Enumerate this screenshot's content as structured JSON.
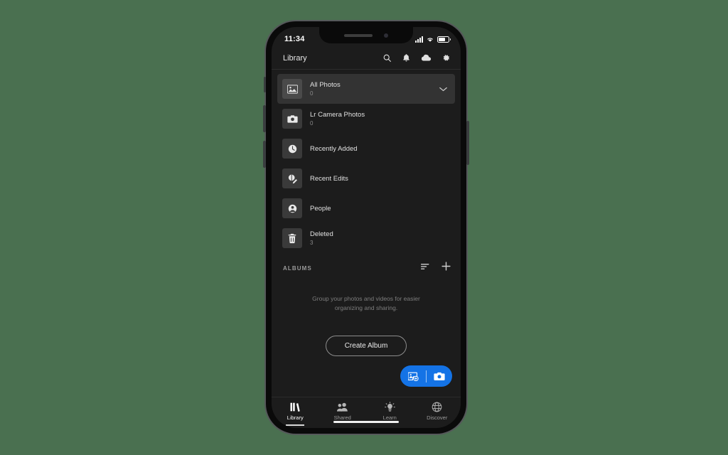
{
  "device": {
    "status_bar": {
      "time": "11:34",
      "icons": [
        "signal-bars-icon",
        "wifi-icon",
        "battery-icon"
      ]
    },
    "notch": [
      "speaker-slot",
      "front-camera-dot"
    ],
    "side_buttons": [
      "mute-switch",
      "volume-up-button",
      "volume-down-button",
      "power-button"
    ],
    "home_indicator": true
  },
  "header": {
    "title": "Library",
    "actions": [
      {
        "name": "search-icon",
        "label": "Search"
      },
      {
        "name": "bell-icon",
        "label": "Notifications"
      },
      {
        "name": "cloud-icon",
        "label": "Cloud Sync"
      },
      {
        "name": "gear-icon",
        "label": "Settings"
      }
    ]
  },
  "library": {
    "items": [
      {
        "title": "All Photos",
        "count": "0",
        "icon": "photo-icon",
        "selected": true,
        "chevron": true
      },
      {
        "title": "Lr Camera Photos",
        "count": "0",
        "icon": "camera-icon",
        "selected": false,
        "chevron": false
      },
      {
        "title": "Recently Added",
        "count": "",
        "icon": "clock-icon",
        "selected": false,
        "chevron": false
      },
      {
        "title": "Recent Edits",
        "count": "",
        "icon": "edit-circle-icon",
        "selected": false,
        "chevron": false
      },
      {
        "title": "People",
        "count": "",
        "icon": "person-icon",
        "selected": false,
        "chevron": false
      },
      {
        "title": "Deleted",
        "count": "3",
        "icon": "trash-icon",
        "selected": false,
        "chevron": false
      }
    ]
  },
  "albums": {
    "section_label": "ALBUMS",
    "sort_icon": "sort-icon",
    "add_icon": "plus-icon",
    "empty_message": "Group your photos and videos for easier organizing and sharing.",
    "create_button_label": "Create Album"
  },
  "fab": {
    "add_photos_icon": "add-photos-icon",
    "camera_icon": "camera-icon",
    "color": "#1473e6"
  },
  "tabs": [
    {
      "label": "Library",
      "icon": "books-icon",
      "active": true
    },
    {
      "label": "Shared",
      "icon": "people-icon",
      "active": false
    },
    {
      "label": "Learn",
      "icon": "lightbulb-icon",
      "active": false
    },
    {
      "label": "Discover",
      "icon": "globe-icon",
      "active": false
    }
  ],
  "theme": {
    "page_background": "#4a7050",
    "screen_background": "#1c1c1c",
    "accent": "#1473e6",
    "selected_row": "#333333"
  }
}
